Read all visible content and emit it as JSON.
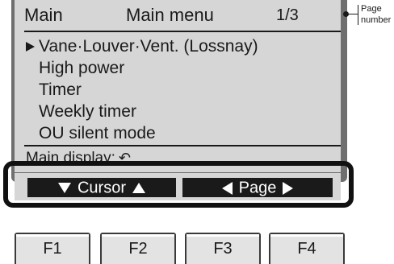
{
  "header": {
    "left": "Main",
    "title": "Main menu",
    "page": "1/3"
  },
  "menu": {
    "items": [
      {
        "label": "Vane·Louver·Vent. (Lossnay)",
        "selected": true
      },
      {
        "label": "High power",
        "selected": false
      },
      {
        "label": "Timer",
        "selected": false
      },
      {
        "label": "Weekly timer",
        "selected": false
      },
      {
        "label": "OU silent mode",
        "selected": false
      }
    ]
  },
  "footer": {
    "label": "Main display:",
    "return_icon": "return-arrow-icon",
    "return_glyph": "↶"
  },
  "soft_keys": {
    "cursor_label": "Cursor",
    "page_label": "Page"
  },
  "callout": {
    "line1": "Page",
    "line2": "number"
  },
  "function_keys": [
    "F1",
    "F2",
    "F3",
    "F4"
  ],
  "colors": {
    "lcd_background": "#d6d6d6",
    "text": "#1a1a1a",
    "bezel": "#6f6f6f"
  }
}
